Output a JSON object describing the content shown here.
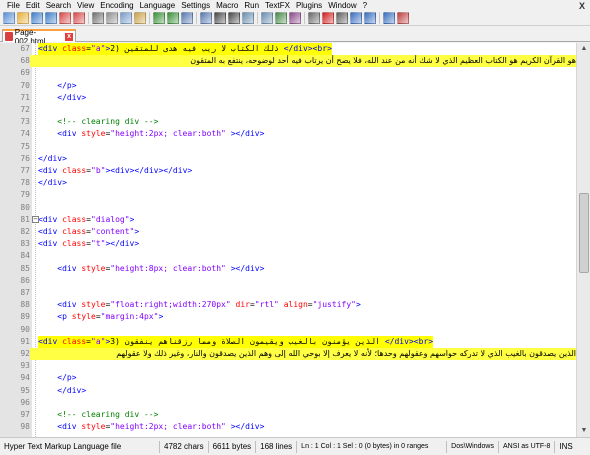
{
  "menu": {
    "items": [
      "File",
      "Edit",
      "Search",
      "View",
      "Encoding",
      "Language",
      "Settings",
      "Macro",
      "Run",
      "TextFX",
      "Plugins",
      "Window",
      "?"
    ],
    "close": "X"
  },
  "tab": {
    "label": "Page-002.html"
  },
  "editor": {
    "lines": [
      {
        "n": "67",
        "code": "<div class=\"a\">2) ذلك الكتاب لا ريب فيه هدى للمتقين </div><br>",
        "hl": "partial"
      },
      {
        "n": "68",
        "code": "هو القرآن الكريم هو الكتاب العظيم الذي لا شك أنه من عند الله، فلا يصح أن يرتاب فيه أحد لوضوحه، ينتفع به المتقون",
        "rtl": true,
        "hl": "full"
      },
      {
        "n": "69",
        "code": ""
      },
      {
        "n": "70",
        "code": "    </p>"
      },
      {
        "n": "71",
        "code": "    </div>"
      },
      {
        "n": "72",
        "code": ""
      },
      {
        "n": "73",
        "code": "    <!-- clearing div -->"
      },
      {
        "n": "74",
        "code": "    <div style=\"height:2px; clear:both\" ></div>"
      },
      {
        "n": "75",
        "code": ""
      },
      {
        "n": "76",
        "code": "</div>"
      },
      {
        "n": "77",
        "code": "<div class=\"b\"><div></div></div>"
      },
      {
        "n": "78",
        "code": "</div>"
      },
      {
        "n": "79",
        "code": ""
      },
      {
        "n": "80",
        "code": ""
      },
      {
        "n": "81",
        "code": "<div class=\"dialog\">"
      },
      {
        "n": "82",
        "code": "<div class=\"content\">"
      },
      {
        "n": "83",
        "code": "<div class=\"t\"></div>"
      },
      {
        "n": "84",
        "code": ""
      },
      {
        "n": "85",
        "code": "    <div style=\"height:8px; clear:both\" ></div>"
      },
      {
        "n": "86",
        "code": ""
      },
      {
        "n": "87",
        "code": ""
      },
      {
        "n": "88",
        "code": "    <div style=\"float:right;width:270px\" dir=\"rtl\" align=\"justify\">"
      },
      {
        "n": "89",
        "code": "    <p style=\"margin:4px\">"
      },
      {
        "n": "90",
        "code": ""
      },
      {
        "n": "91",
        "code": "<div class=\"a\">3) الذين يؤمنون بالغيب ويقيمون الصلاة ومما رزقناهم ينفقون </div><br>",
        "hl": "partial"
      },
      {
        "n": "92",
        "code": "الذين يصدقون بالغيب الذي لا تدركه حواسهم وعقولهم وحدها؛ لأنه لا يعرف إلا بوحي الله إلى وهم الذين يصدقون والنار، وغير ذلك ولا عقولهم",
        "rtl": true,
        "hl": "full"
      },
      {
        "n": "93",
        "code": ""
      },
      {
        "n": "94",
        "code": "    </p>"
      },
      {
        "n": "95",
        "code": "    </div>"
      },
      {
        "n": "96",
        "code": ""
      },
      {
        "n": "97",
        "code": "    <!-- clearing div -->"
      },
      {
        "n": "98",
        "code": "    <div style=\"height:2px; clear:both\" ></div>"
      }
    ]
  },
  "status": {
    "filetype": "Hyper Text Markup Language file",
    "chars": "4782 chars",
    "bytes": "6611 bytes",
    "lines": "168 lines",
    "position": "Ln : 1    Col : 1    Sel : 0 (0 bytes) in 0 ranges",
    "eol": "Dos\\Windows",
    "encoding": "ANSI as UTF-8",
    "mode": "INS"
  },
  "colors": {
    "highlight": "#ffff00",
    "tag": "#0000ff",
    "attr": "#ff0000",
    "value": "#8000ff",
    "comment": "#008000",
    "tab_accent": "#f9a23f"
  },
  "toolbar": {
    "icons": [
      "new-icon",
      "open-icon",
      "save-icon",
      "save-all-icon",
      "close-icon",
      "close-all-icon",
      "print-icon",
      "cut-icon",
      "copy-icon",
      "paste-icon",
      "undo-icon",
      "redo-icon",
      "find-icon",
      "replace-icon",
      "zoom-in-icon",
      "zoom-out-icon",
      "sync-v-icon",
      "sync-h-icon",
      "wrap-icon",
      "all-chars-icon",
      "indent-guide-icon",
      "record-macro-icon",
      "stop-macro-icon",
      "play-macro-icon",
      "run-macro-icon",
      "save-macro-icon",
      "spellcheck-icon"
    ]
  }
}
